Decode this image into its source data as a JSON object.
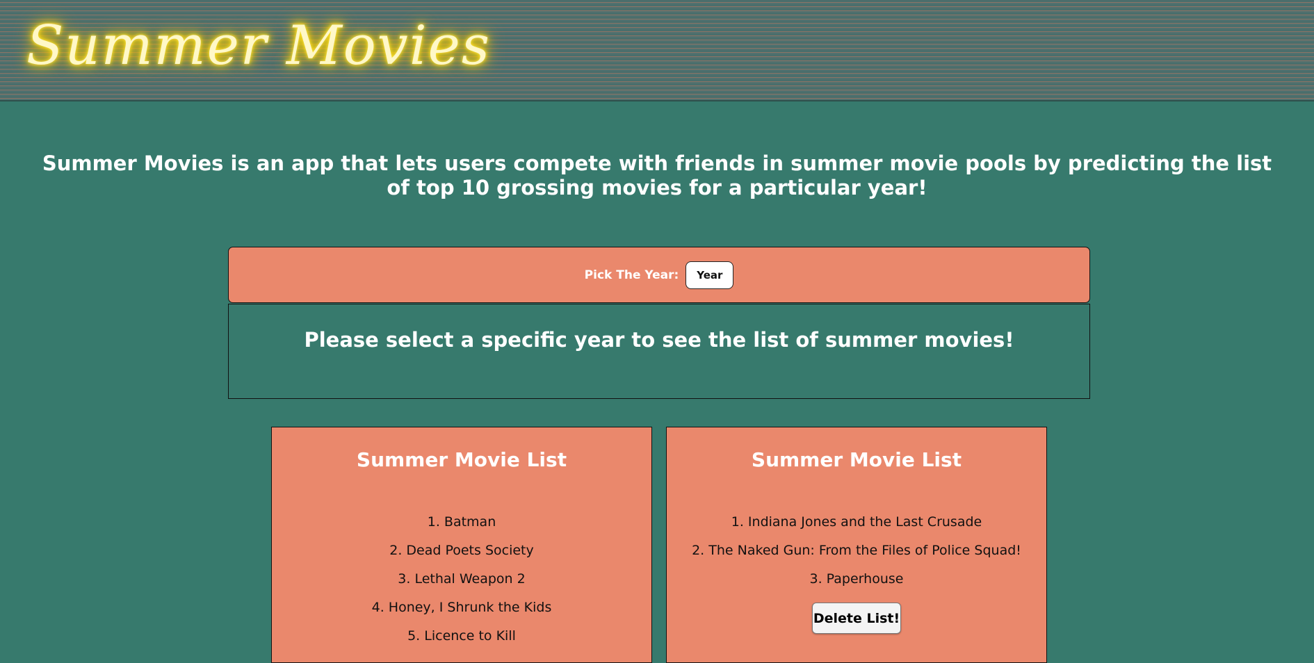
{
  "header": {
    "logo_text": "Summer Movies"
  },
  "intro": {
    "text": "Summer Movies is an app that lets users compete with friends in summer movie pools by predicting the list of top 10 grossing movies for a particular year!"
  },
  "year_picker": {
    "label": "Pick The Year:",
    "selected": "Year"
  },
  "message": {
    "text": "Please select a specific year to see the list of summer movies!"
  },
  "lists": [
    {
      "title": "Summer Movie List",
      "movies": [
        "1. Batman",
        "2. Dead Poets Society",
        "3. Lethal Weapon 2",
        "4. Honey, I Shrunk the Kids",
        "5. Licence to Kill"
      ]
    },
    {
      "title": "Summer Movie List",
      "movies": [
        "1. Indiana Jones and the Last Crusade",
        "2. The Naked Gun: From the Files of Police Squad!",
        "3. Paperhouse"
      ],
      "delete_label": "Delete List!"
    }
  ],
  "colors": {
    "background": "#377a6d",
    "panel": "#ea886c",
    "neon": "#ffe84a"
  }
}
